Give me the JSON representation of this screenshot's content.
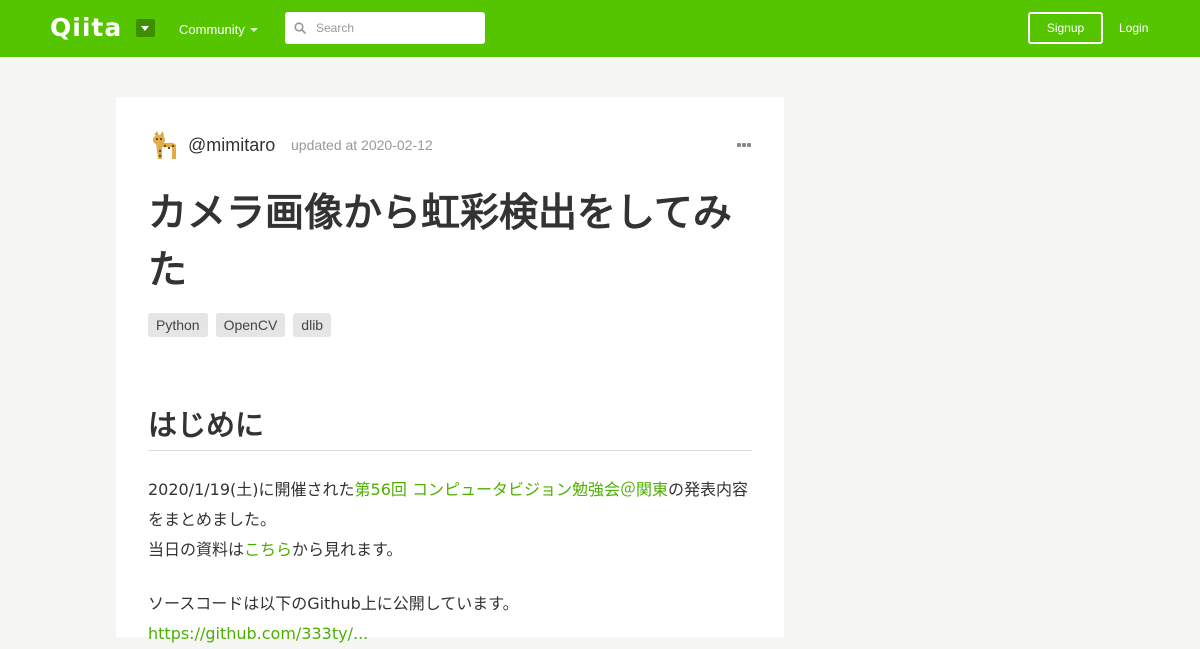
{
  "header": {
    "logo": "Qiita",
    "community_label": "Community",
    "search_placeholder": "Search",
    "signup_label": "Signup",
    "login_label": "Login"
  },
  "article": {
    "author": "@mimitaro",
    "updated": "updated at 2020-02-12",
    "title": "カメラ画像から虹彩検出をしてみた",
    "tags": [
      "Python",
      "OpenCV",
      "dlib"
    ],
    "section_heading": "はじめに",
    "p1_before": "2020/1/19(土)に開催された",
    "p1_link": "第56回 コンピュータビジョン勉強会＠関東",
    "p1_after": "の発表内容をまとめました。",
    "p2_before": "当日の資料は",
    "p2_link": "こちら",
    "p2_after": "から見れます。",
    "p3": "ソースコードは以下のGithub上に公開しています。",
    "p4_link": "https://github.com/333ty/..."
  },
  "colors": {
    "brand": "#55c500",
    "link": "#4db000"
  }
}
